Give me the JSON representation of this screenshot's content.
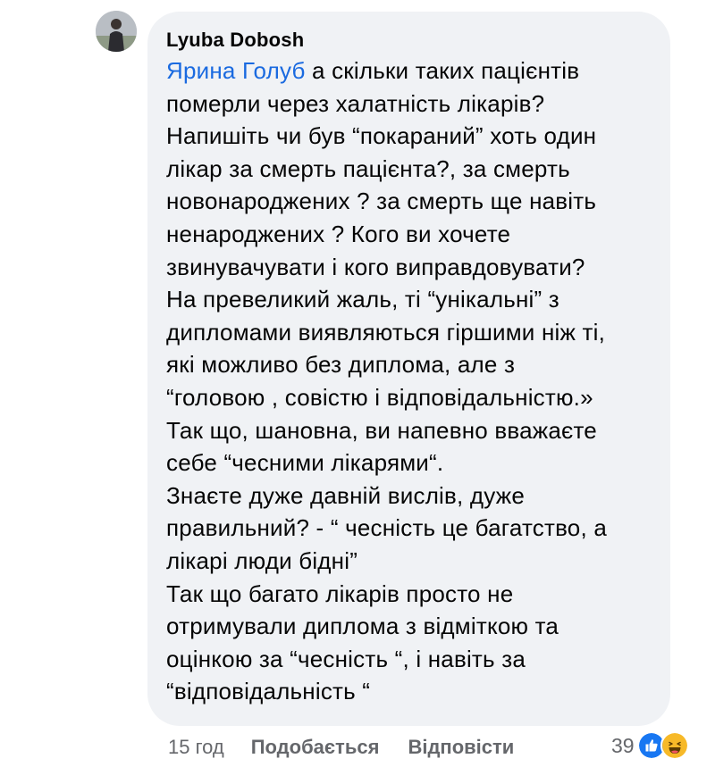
{
  "comment": {
    "author": "Lyuba Dobosh",
    "mention": "Ярина Голуб",
    "lines": [
      " а скільки таких пацієнтів",
      "померли через халатність лікарів?",
      "Напишіть чи був “покараний” хоть один",
      "лікар за смерть пацієнта?, за смерть",
      "новонароджених ? за смерть ще навіть",
      "ненароджених ? Кого ви хочете",
      "звинувачувати і кого виправдовувати?",
      "На превеликий жаль, ті “унікальні” з",
      "дипломами виявляються гіршими ніж ті,",
      "які можливо без диплома, але з",
      "“головою , совістю і відповідальністю.»",
      "Так що, шановна, ви напевно вважаєте",
      "себе “чесними лікарями“.",
      "Знаєте дуже давній вислів, дуже",
      "правильний? - “ чесність це багатство, а",
      "лікарі люди бідні”",
      "Так що багато лікарів просто не",
      "отримували диплома з відміткою та",
      "оцінкою за “чесність “, і навіть за",
      "“відповідальність “"
    ]
  },
  "actions": {
    "time": "15 год",
    "like_label": "Подобається",
    "reply_label": "Відповісти"
  },
  "reactions": {
    "count": "39",
    "icons": [
      "like-icon",
      "haha-icon"
    ],
    "colors": {
      "like": "#1877f2",
      "haha": "#f7b928"
    }
  },
  "colors": {
    "bubble": "#f0f2f5",
    "text": "#050505",
    "mention": "#1a6ae0",
    "meta": "#65676b"
  }
}
